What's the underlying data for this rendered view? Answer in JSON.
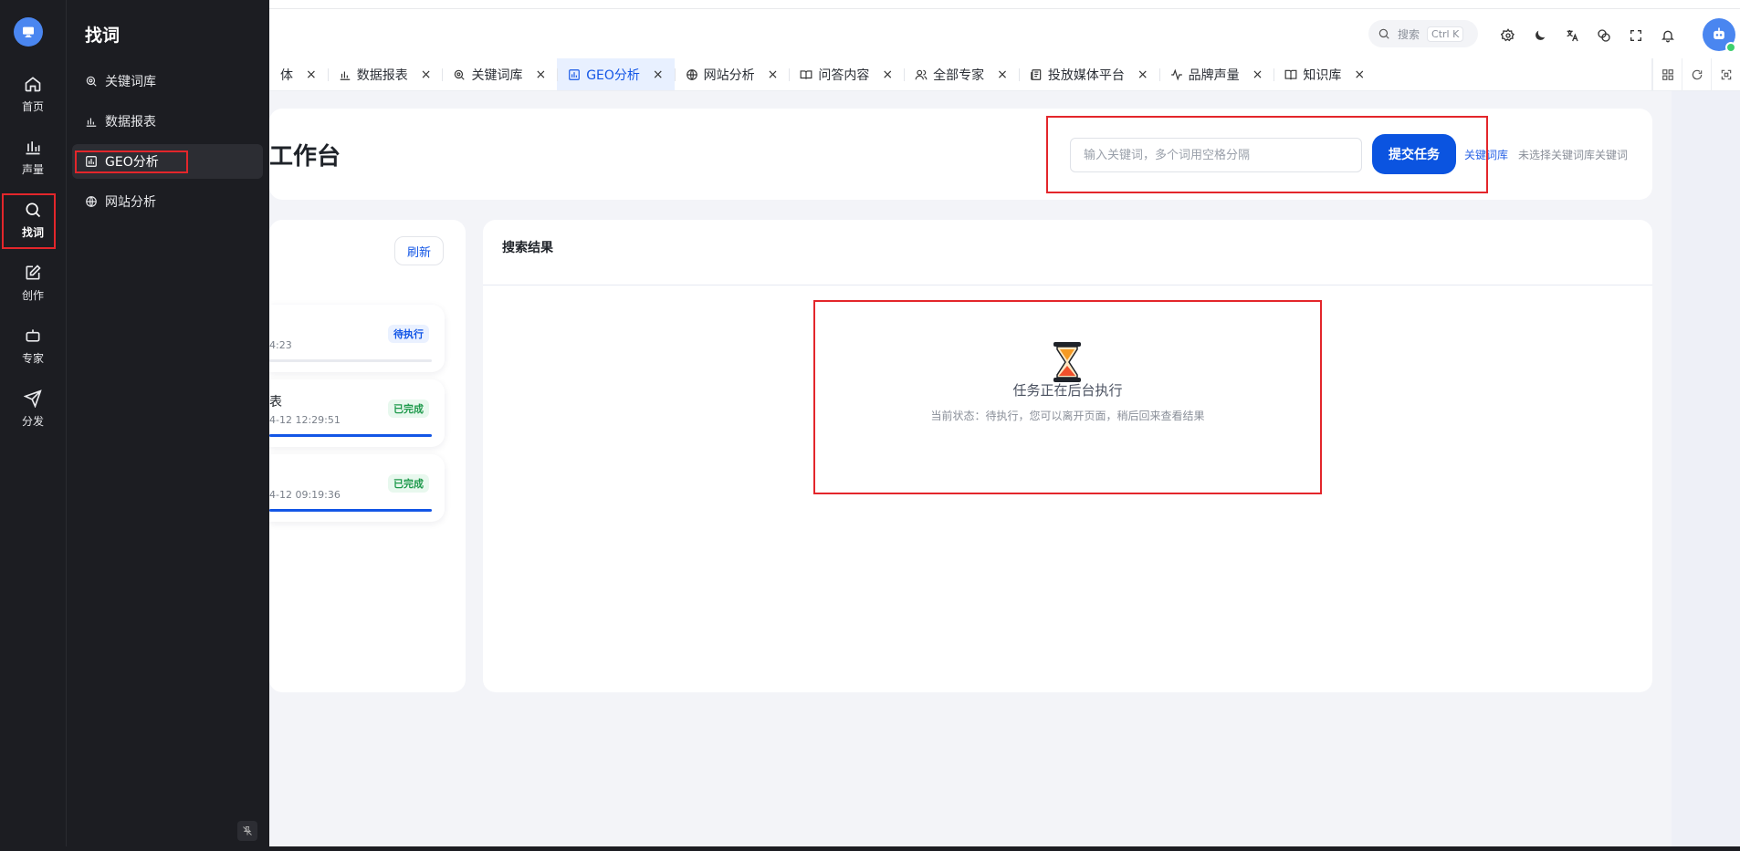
{
  "header": {
    "search_label": "搜索",
    "search_shortcut": "Ctrl K"
  },
  "rail": {
    "items": [
      {
        "label": "首页"
      },
      {
        "label": "声量"
      },
      {
        "label": "找词"
      },
      {
        "label": "创作"
      },
      {
        "label": "专家"
      },
      {
        "label": "分发"
      }
    ]
  },
  "flyout": {
    "title": "找词",
    "items": [
      {
        "label": "关键词库"
      },
      {
        "label": "数据报表"
      },
      {
        "label": "GEO分析"
      },
      {
        "label": "网站分析"
      }
    ]
  },
  "tabs": [
    {
      "label": "体",
      "close": "×"
    },
    {
      "label": "数据报表",
      "close": "×"
    },
    {
      "label": "关键词库",
      "close": "×"
    },
    {
      "label": "GEO分析",
      "close": "×"
    },
    {
      "label": "网站分析",
      "close": "×"
    },
    {
      "label": "问答内容",
      "close": "×"
    },
    {
      "label": "全部专家",
      "close": "×"
    },
    {
      "label": "投放媒体平台",
      "close": "×"
    },
    {
      "label": "品牌声量",
      "close": "×"
    },
    {
      "label": "知识库",
      "close": "×"
    }
  ],
  "workbench": {
    "title": "工作台",
    "keyword_placeholder": "输入关键词，多个词用空格分隔",
    "submit_label": "提交任务",
    "kb_link": "关键词库",
    "kb_hint": "未选择关键词库关键词"
  },
  "tasks": {
    "refresh_label": "刷新",
    "items": [
      {
        "name": "",
        "time": "4:23",
        "status": "待执行",
        "status_type": "pending",
        "progress": 0
      },
      {
        "name": "表",
        "time": "4-12 12:29:51",
        "status": "已完成",
        "status_type": "done",
        "progress": 100
      },
      {
        "name": "",
        "time": "4-12 09:19:36",
        "status": "已完成",
        "status_type": "done",
        "progress": 100
      }
    ]
  },
  "results": {
    "title": "搜索结果",
    "empty_title": "任务正在后台执行",
    "empty_sub": "当前状态：待执行，您可以离开页面，稍后回来查看结果"
  },
  "colors": {
    "accent": "#0b54e0",
    "highlight": "#e3262b",
    "sidebar": "#1c1d22"
  }
}
